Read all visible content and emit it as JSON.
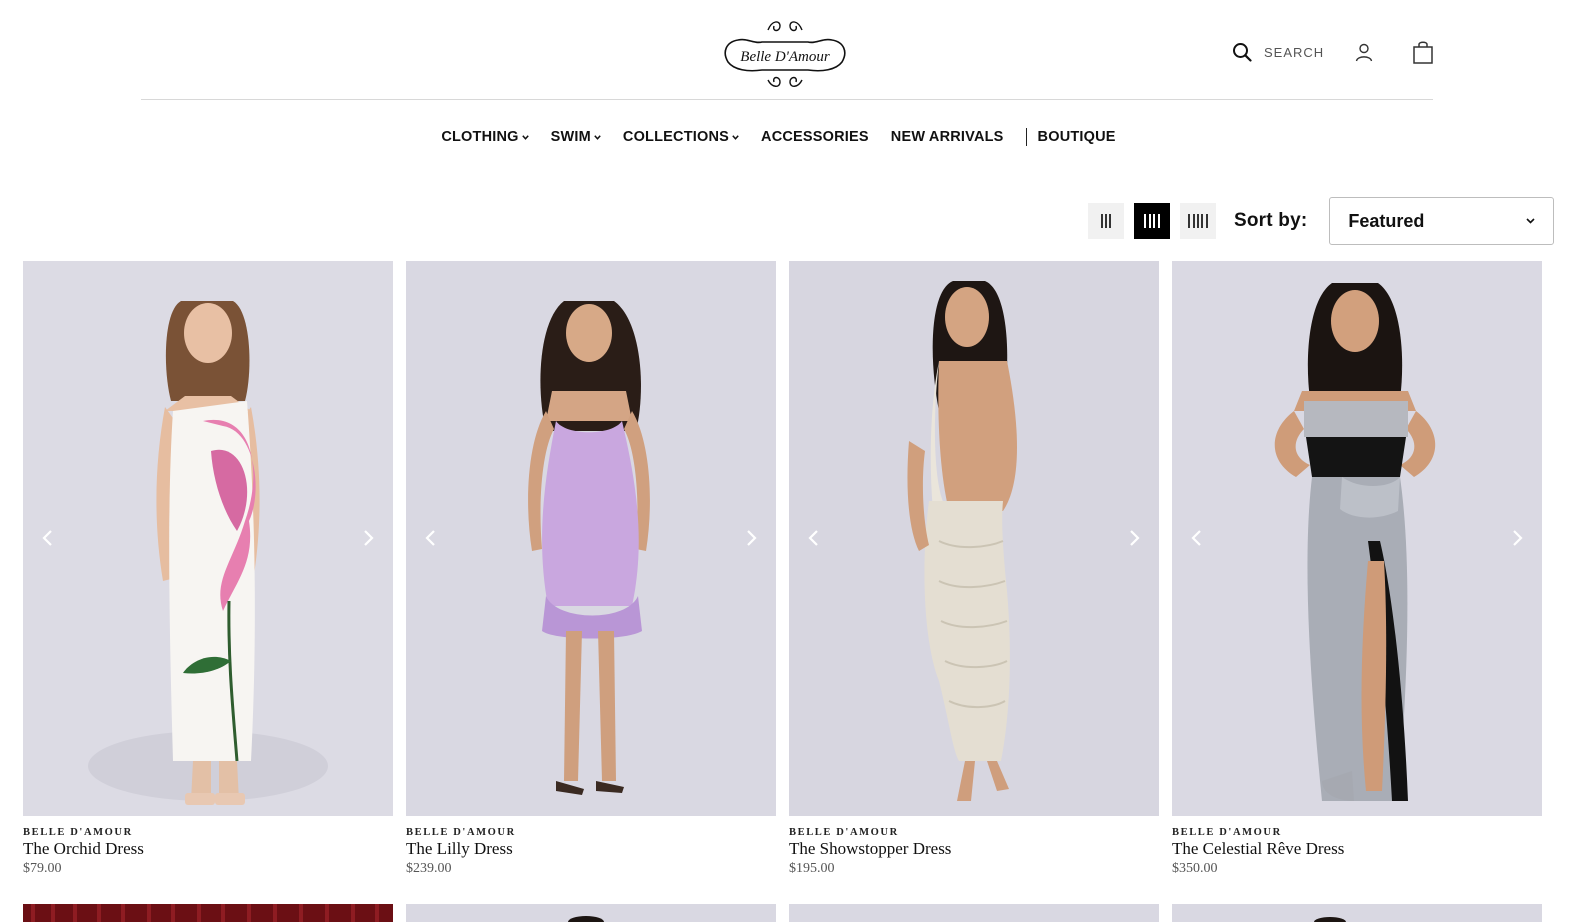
{
  "header": {
    "logo_text": "Belle D'Amour",
    "search_label": "SEARCH"
  },
  "nav": {
    "items": [
      {
        "label": "CLOTHING",
        "dropdown": true
      },
      {
        "label": "SWIM",
        "dropdown": true
      },
      {
        "label": "COLLECTIONS",
        "dropdown": true
      },
      {
        "label": "ACCESSORIES",
        "dropdown": false
      },
      {
        "label": "NEW ARRIVALS",
        "dropdown": false
      },
      {
        "label": "BOUTIQUE",
        "dropdown": false
      }
    ]
  },
  "toolbar": {
    "sort_label": "Sort by:",
    "sort_value": "Featured",
    "grid_options": [
      "3 columns",
      "4 columns",
      "5 columns"
    ],
    "active_grid": "4 columns"
  },
  "products": [
    {
      "brand": "BELLE D'AMOUR",
      "name": "The Orchid Dress",
      "price": "$79.00"
    },
    {
      "brand": "BELLE D'AMOUR",
      "name": "The Lilly Dress",
      "price": "$239.00"
    },
    {
      "brand": "BELLE D'AMOUR",
      "name": "The Showstopper Dress",
      "price": "$195.00"
    },
    {
      "brand": "BELLE D'AMOUR",
      "name": "The Celestial Rêve Dress",
      "price": "$350.00"
    }
  ],
  "colors": {
    "image_bg": "#d8d7e2",
    "row2_first": "#6b0f14",
    "accent": "#000000"
  }
}
